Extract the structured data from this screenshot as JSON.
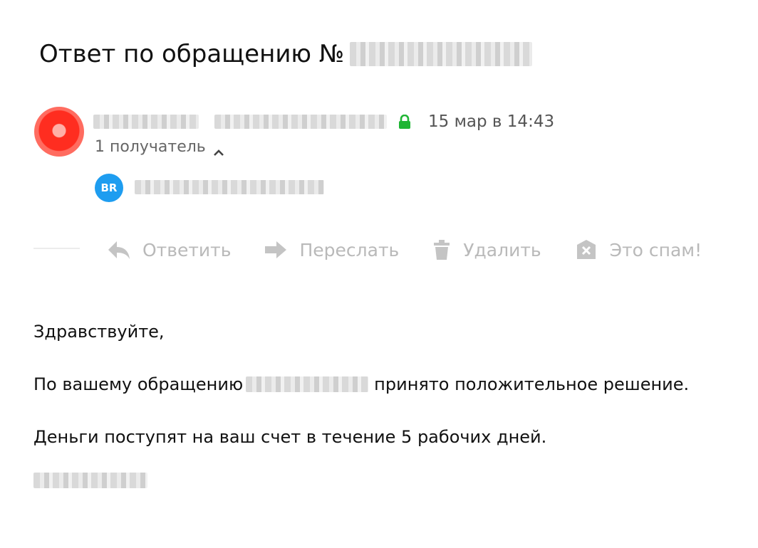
{
  "email": {
    "subject_prefix": "Ответ по обращению №",
    "subject_ref_redacted": "",
    "sender": {
      "name_redacted": "",
      "email_redacted": "",
      "avatar_color": "#ff2d20",
      "secure_icon": "lock-icon"
    },
    "date": "15 мар в 14:43",
    "recipients_label": "1 получатель",
    "recipient": {
      "initials": "BR",
      "avatar_color": "#1e9df0",
      "email_redacted": ""
    }
  },
  "toolbar": {
    "reply": {
      "label": "Ответить",
      "icon": "reply-icon"
    },
    "forward": {
      "label": "Переслать",
      "icon": "forward-icon"
    },
    "delete": {
      "label": "Удалить",
      "icon": "trash-icon"
    },
    "spam": {
      "label": "Это спам!",
      "icon": "spam-icon"
    },
    "color": "#b9b9b9"
  },
  "message": {
    "greeting": "Здравствуйте,",
    "line1_before": "По вашему обращению",
    "line1_after": "принято положительное решение.",
    "line2": "Деньги поступят на ваш счет в течение 5 рабочих дней."
  }
}
